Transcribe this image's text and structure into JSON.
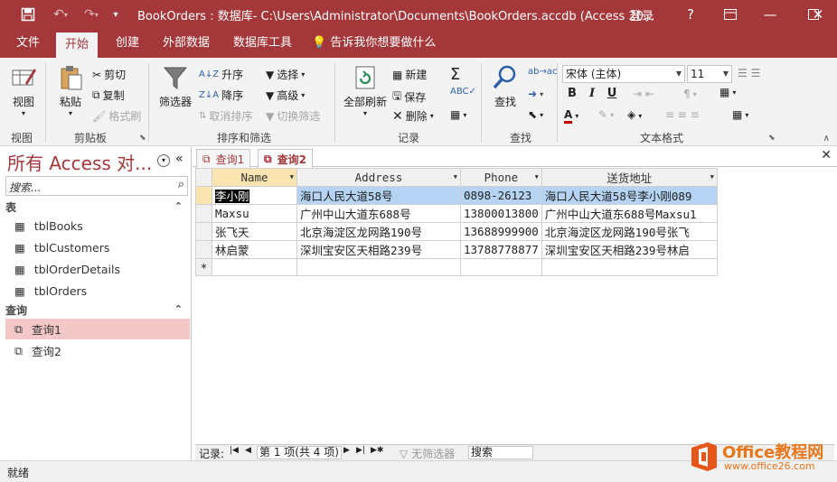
{
  "titlebar": {
    "title": "BookOrders : 数据库- C:\\Users\\Administrator\\Documents\\BookOrders.accdb (Access 20...",
    "login": "登录",
    "help": "?"
  },
  "tabs": [
    "文件",
    "开始",
    "创建",
    "外部数据",
    "数据库工具"
  ],
  "tell_me": "告诉我你想要做什么",
  "ribbon": {
    "view": {
      "label": "视图",
      "group": "视图"
    },
    "clipboard": {
      "paste": "粘贴",
      "cut": "剪切",
      "copy": "复制",
      "format_painter": "格式刷",
      "group": "剪贴板"
    },
    "sort_filter": {
      "filter": "筛选器",
      "asc": "升序",
      "desc": "降序",
      "remove_sort": "取消排序",
      "selection": "选择",
      "advanced": "高级",
      "toggle_filter": "切换筛选",
      "group": "排序和筛选"
    },
    "records": {
      "refresh": "全部刷新",
      "new": "新建",
      "save": "保存",
      "delete": "删除",
      "group": "记录"
    },
    "find": {
      "find": "查找",
      "group": "查找"
    },
    "text_format": {
      "font": "宋体 (主体)",
      "size": "11",
      "bold": "B",
      "italic": "I",
      "underline": "U",
      "group": "文本格式"
    }
  },
  "nav": {
    "title": "所有 Access 对...",
    "search_placeholder": "搜索...",
    "sections": [
      {
        "label": "表",
        "items": [
          "tblBooks",
          "tblCustomers",
          "tblOrderDetails",
          "tblOrders"
        ]
      },
      {
        "label": "查询",
        "items": [
          "查询1",
          "查询2"
        ]
      }
    ]
  },
  "doc_tabs": [
    "查询1",
    "查询2"
  ],
  "sheet": {
    "columns": [
      "Name",
      "Address",
      "Phone",
      "送货地址"
    ],
    "rows": [
      [
        "李小刚",
        "海口人民大道58号",
        "0898-26123",
        "海口人民大道58号李小刚089"
      ],
      [
        "Maxsu",
        "广州中山大道东688号",
        "13800013800",
        "广州中山大道东688号Maxsu1"
      ],
      [
        "张飞天",
        "北京海淀区龙网路190号",
        "13688999900",
        "北京海淀区龙网路190号张飞"
      ],
      [
        "林启蒙",
        "深圳宝安区天相路239号",
        "13788778877",
        "深圳宝安区天相路239号林启"
      ]
    ],
    "new_row_marker": "*"
  },
  "record_nav": {
    "label": "记录:",
    "position": "第 1 项(共 4 项)",
    "filter": "无筛选器",
    "search": "搜索"
  },
  "status": {
    "text": "就绪"
  },
  "watermark": {
    "brand": "Office教程网",
    "url": "www.office26.com"
  },
  "colors": {
    "accent": "#a4373a",
    "selection": "#b5d3f3",
    "nav_selected": "#f4c7c9"
  }
}
